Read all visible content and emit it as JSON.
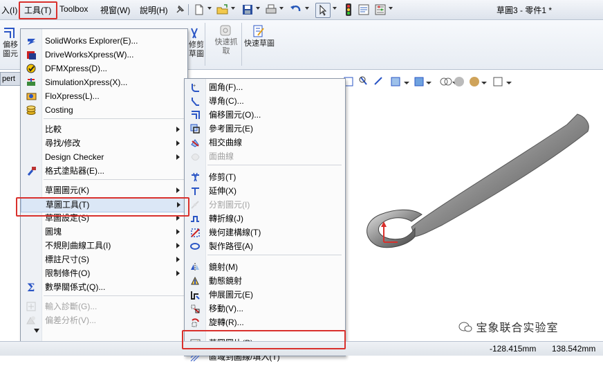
{
  "menubar": {
    "insert_partial": "入(I)",
    "tools": "工具(T)",
    "toolbox": "Toolbox",
    "view": "視窗(W)",
    "help": "說明(H)",
    "doc_title": "草圖3 - 零件1 *"
  },
  "ribbon": {
    "offset_entities": "偏移圖元",
    "trim_fragment": "修剪草圖",
    "quick_snaps": "快速抓取",
    "rapid_sketch": "快速草圖"
  },
  "tree_tab": "pert",
  "tools_menu": {
    "items": [
      {
        "label": "SolidWorks Explorer(E)...",
        "icon": "solidworks-explorer-icon",
        "submenu": false,
        "disabled": false
      },
      {
        "label": "DriveWorksXpress(W)...",
        "icon": "driveworks-icon",
        "submenu": false,
        "disabled": false
      },
      {
        "label": "DFMXpress(D)...",
        "icon": "dfmxpress-icon",
        "submenu": false,
        "disabled": false
      },
      {
        "label": "SimulationXpress(X)...",
        "icon": "simulation-icon",
        "submenu": false,
        "disabled": false
      },
      {
        "label": "FloXpress(L)...",
        "icon": "floxpress-icon",
        "submenu": false,
        "disabled": false
      },
      {
        "label": "Costing",
        "icon": "costing-icon",
        "submenu": false,
        "disabled": false
      },
      {
        "label": "比較",
        "icon": "",
        "submenu": true,
        "disabled": false
      },
      {
        "label": "尋找/修改",
        "icon": "",
        "submenu": true,
        "disabled": false
      },
      {
        "label": "Design Checker",
        "icon": "",
        "submenu": true,
        "disabled": false
      },
      {
        "label": "格式塗貼器(E)...",
        "icon": "format-painter-icon",
        "submenu": false,
        "disabled": false
      },
      {
        "label": "草圖圖元(K)",
        "icon": "",
        "submenu": true,
        "disabled": false
      },
      {
        "label": "草圖工具(T)",
        "icon": "",
        "submenu": true,
        "disabled": false
      },
      {
        "label": "草圖設定(S)",
        "icon": "",
        "submenu": true,
        "disabled": false
      },
      {
        "label": "圖塊",
        "icon": "",
        "submenu": true,
        "disabled": false
      },
      {
        "label": "不規則曲線工具(I)",
        "icon": "",
        "submenu": true,
        "disabled": false
      },
      {
        "label": "標註尺寸(S)",
        "icon": "",
        "submenu": true,
        "disabled": false
      },
      {
        "label": "限制條件(O)",
        "icon": "",
        "submenu": true,
        "disabled": false
      },
      {
        "label": "數學關係式(Q)...",
        "icon": "sigma-icon",
        "submenu": false,
        "disabled": false
      },
      {
        "label": "輸入診斷(G)...",
        "icon": "import-diagnostics-icon",
        "submenu": false,
        "disabled": true
      },
      {
        "label": "偏差分析(V)...",
        "icon": "deviation-analysis-icon",
        "submenu": false,
        "disabled": true
      }
    ]
  },
  "sketch_tools_menu": {
    "items": [
      {
        "label": "圓角(F)...",
        "icon": "fillet-icon",
        "disabled": false
      },
      {
        "label": "導角(C)...",
        "icon": "chamfer-icon",
        "disabled": false
      },
      {
        "label": "偏移圖元(O)...",
        "icon": "offset-icon",
        "disabled": false
      },
      {
        "label": "參考圖元(E)",
        "icon": "convert-entities-icon",
        "disabled": false
      },
      {
        "label": "相交曲線",
        "icon": "intersection-curve-icon",
        "disabled": false
      },
      {
        "label": "面曲線",
        "icon": "face-curves-icon",
        "disabled": true
      },
      {
        "label": "修剪(T)",
        "icon": "trim-icon",
        "disabled": false
      },
      {
        "label": "延伸(X)",
        "icon": "extend-icon",
        "disabled": false
      },
      {
        "label": "分割圖元(I)",
        "icon": "split-entities-icon",
        "disabled": true
      },
      {
        "label": "轉折線(J)",
        "icon": "jog-line-icon",
        "disabled": false
      },
      {
        "label": "幾何建構線(T)",
        "icon": "construction-geometry-icon",
        "disabled": false
      },
      {
        "label": "製作路徑(A)",
        "icon": "make-path-icon",
        "disabled": false
      },
      {
        "label": "鏡射(M)",
        "icon": "mirror-icon",
        "disabled": false
      },
      {
        "label": "動態鏡射",
        "icon": "dynamic-mirror-icon",
        "disabled": false
      },
      {
        "label": "伸展圖元(E)",
        "icon": "stretch-entities-icon",
        "disabled": false
      },
      {
        "label": "移動(V)...",
        "icon": "move-icon",
        "disabled": false
      },
      {
        "label": "旋轉(R)...",
        "icon": "rotate-icon",
        "disabled": false
      },
      {
        "label": "草圖圖片(P)...",
        "icon": "sketch-picture-icon",
        "disabled": false
      },
      {
        "label": "區域到圖線/填入(T)",
        "icon": "area-hatch-icon",
        "disabled": false
      }
    ]
  },
  "status": {
    "x_coord": "-128.415mm",
    "y_coord": "138.542mm"
  },
  "watermark": "宝象联合实验室",
  "colors": {
    "highlight_box": "#d9302c",
    "menu_bg": "#fbfbfb"
  }
}
